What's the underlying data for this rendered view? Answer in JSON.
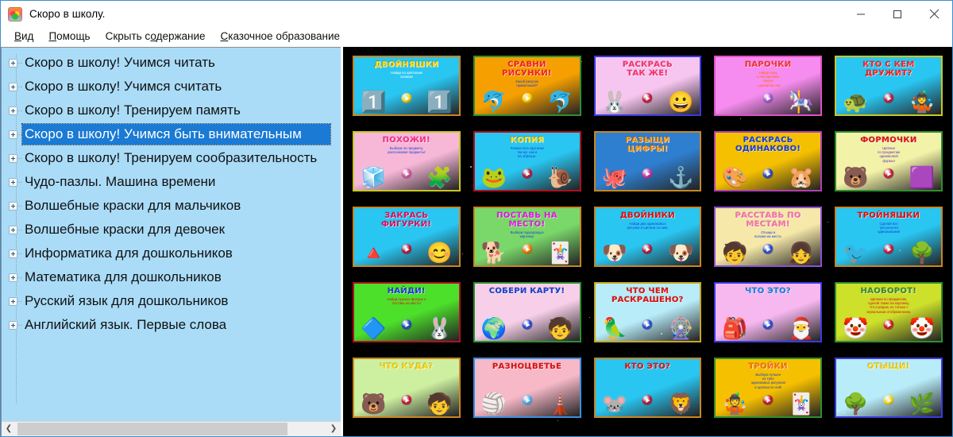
{
  "window": {
    "title": "Скоро в школу.",
    "app_icon": "school-app-icon",
    "minimize_label": "−",
    "maximize_label": "▢",
    "close_label": "✕"
  },
  "menubar": {
    "items": [
      {
        "name": "menu-view",
        "accel": "В",
        "rest": "ид"
      },
      {
        "name": "menu-help",
        "accel": "П",
        "rest": "омощь"
      },
      {
        "name": "menu-hide-contents",
        "prefix": "Скрыть с",
        "accel": "о",
        "rest": "держание"
      },
      {
        "name": "menu-fairy-education",
        "accel": "С",
        "rest": "казочное образование"
      }
    ]
  },
  "tree": {
    "items": [
      {
        "label": "Скоро в школу! Учимся читать",
        "selected": false
      },
      {
        "label": "Скоро в школу! Учимся считать",
        "selected": false
      },
      {
        "label": "Скоро в школу! Тренируем память",
        "selected": false
      },
      {
        "label": "Скоро в школу! Учимся быть внимательным",
        "selected": true
      },
      {
        "label": "Скоро в школу! Тренируем сообразительность",
        "selected": false
      },
      {
        "label": "Чудо-пазлы. Машина времени",
        "selected": false
      },
      {
        "label": "Волшебные краски для мальчиков",
        "selected": false
      },
      {
        "label": "Волшебные краски для девочек",
        "selected": false
      },
      {
        "label": "Информатика для дошкольников",
        "selected": false
      },
      {
        "label": "Математика для дошкольников",
        "selected": false
      },
      {
        "label": "Русский язык для дошкольников",
        "selected": false
      },
      {
        "label": "Английский язык. Первые слова",
        "selected": false
      }
    ],
    "hscroll": {
      "left_arrow": "❮",
      "right_arrow": "❯"
    }
  },
  "grid": {
    "thumbnails": [
      {
        "title": "ДВОЙНЯШКИ",
        "subtitle": "Найди по цветовым\nсхемам!",
        "bg": "#29c6f2",
        "border": "#c8861f",
        "title_color": "#ffd400",
        "sub_color": "#ffffff",
        "play_color": "#ffd400",
        "art_left": "1️⃣",
        "art_right": "1️⃣"
      },
      {
        "title": "СРАВНИ\nРИСУНКИ!",
        "subtitle": "Какой рисунок\nправильный?",
        "bg": "#f5a000",
        "border": "#2f8f2f",
        "title_color": "#ff2020",
        "sub_color": "#1b3fd0",
        "play_color": "#ffd400",
        "art_left": "🐬",
        "art_right": "🐬"
      },
      {
        "title": "РАСКРАСЬ\nТАК ЖЕ!",
        "subtitle": "",
        "bg": "#f7c6f0",
        "border": "#3a3ae0",
        "title_color": "#ff3070",
        "sub_color": "#1b3fd0",
        "play_color": "#c01030",
        "art_left": "🐰",
        "art_right": "😀"
      },
      {
        "title": "ПАРОЧКИ",
        "subtitle": "Найди пару\nк той картинке\nсверху\n- сделай бы им!",
        "bg": "#f78cf0",
        "border": "#e050c8",
        "title_color": "#ff3030",
        "sub_color": "#ff6a00",
        "play_color": "#9b59d0",
        "art_left": "",
        "art_right": "🎠"
      },
      {
        "title": "КТО С КЕМ\nДРУЖИТ?",
        "subtitle": "",
        "bg": "#29c6f2",
        "border": "#c8c81f",
        "title_color": "#ff2020",
        "sub_color": "#ffffff",
        "play_color": "#d01030",
        "art_left": "🐢",
        "art_right": "🤹"
      },
      {
        "title": "ПОХОЖИ!",
        "subtitle": "Выбери по предмету,\nраспознавая предметы!",
        "bg": "#f7b8d8",
        "border": "#c8c81f",
        "title_color": "#ff3090",
        "sub_color": "#1b3fd0",
        "play_color": "#d050a0",
        "art_left": "🧊",
        "art_right": "🧩"
      },
      {
        "title": "КОПИЯ",
        "subtitle": "Разместите картинки\nтак же, как и\nна образце.",
        "bg": "#29c6f2",
        "border": "#b01020",
        "title_color": "#ffd400",
        "sub_color": "#1b3fd0",
        "play_color": "#c01030",
        "art_left": "🐸",
        "art_right": "🐌"
      },
      {
        "title": "РАЗЫЩИ\nЦИФРЫ!",
        "subtitle": "",
        "bg": "#2f7fd0",
        "border": "#c8861f",
        "title_color": "#ff9000",
        "sub_color": "#ffffff",
        "play_color": "#e030a0",
        "art_left": "🐙",
        "art_right": "⚓"
      },
      {
        "title": "РАСКРАСЬ\nОДИНАКОВО!",
        "subtitle": "",
        "bg": "#f5c000",
        "border": "#b040b0",
        "title_color": "#1b3fd0",
        "sub_color": "#1b3fd0",
        "play_color": "#2040d0",
        "art_left": "🎨",
        "art_right": "🐹"
      },
      {
        "title": "ФОРМОЧКИ",
        "subtitle": "Щёлкни\nпо предметам\nодинаковой\nформы!",
        "bg": "#f2f2a8",
        "border": "#2f8f2f",
        "title_color": "#e01010",
        "sub_color": "#7030c0",
        "play_color": "#c01030",
        "art_left": "🐻",
        "art_right": "🟪"
      },
      {
        "title": "ЗАКРАСЬ\nФИГУРКИ!",
        "subtitle": "",
        "bg": "#29c6f2",
        "border": "#c8861f",
        "title_color": "#e01060",
        "sub_color": "#ffffff",
        "play_color": "#c01030",
        "art_left": "🔺",
        "art_right": "😊"
      },
      {
        "title": "ПОСТАВЬ НА\nМЕСТО!",
        "subtitle": "Выбери подходящую\nкартинку.",
        "bg": "#7ad86a",
        "border": "#c8861f",
        "title_color": "#e020e0",
        "sub_color": "#1b3fd0",
        "play_color": "#ff7000",
        "art_left": "🐕",
        "art_right": "🃏"
      },
      {
        "title": "ДВОЙНИКИ",
        "subtitle": "Найди два одинаковых\nрисунка и щёлкни по ним.",
        "bg": "#29c6f2",
        "border": "#c8861f",
        "title_color": "#e01010",
        "sub_color": "#1b3fd0",
        "play_color": "#c01030",
        "art_left": "🐶",
        "art_right": "🐶"
      },
      {
        "title": "РАССТАВЬ ПО\nМЕСТАМ!",
        "subtitle": "Отыщи и\nположи на место.",
        "bg": "#f5e8a8",
        "border": "#9050d0",
        "title_color": "#ff70b0",
        "sub_color": "#1b3fd0",
        "play_color": "#2040d0",
        "art_left": "🧒",
        "art_right": "👧"
      },
      {
        "title": "ТРОЙНЯШКИ",
        "subtitle": "Сделай все\nтри рисунка\nодинаковыми!",
        "bg": "#29c6f2",
        "border": "#c8861f",
        "title_color": "#e01010",
        "sub_color": "#1b3fd0",
        "play_color": "#d01030",
        "art_left": "🐦",
        "art_right": "🌳"
      },
      {
        "title": "НАЙДИ!",
        "subtitle": "Найди нужные фигуры и\nпоставь на место!",
        "bg": "#4ce02a",
        "border": "#b01020",
        "title_color": "#1b3fd0",
        "sub_color": "#e01010",
        "play_color": "#2040d0",
        "art_left": "🔷",
        "art_right": "🐰"
      },
      {
        "title": "СОБЕРИ КАРТУ!",
        "subtitle": "",
        "bg": "#f7cfe8",
        "border": "#2f8f2f",
        "title_color": "#1b3fd0",
        "sub_color": "#1b3fd0",
        "play_color": "#2040d0",
        "art_left": "🌍",
        "art_right": "🧒"
      },
      {
        "title": "ЧТО ЧЕМ\nРАСКРАШЕНО?",
        "subtitle": "",
        "bg": "#b8ecf8",
        "border": "#c8a81f",
        "title_color": "#e01010",
        "sub_color": "#1b3fd0",
        "play_color": "#2040d0",
        "art_left": "🦜",
        "art_right": "🎡"
      },
      {
        "title": "ЧТО ЭТО?",
        "subtitle": "",
        "bg": "#f7b8f0",
        "border": "#3a3ae0",
        "title_color": "#1b80e0",
        "sub_color": "#1b3fd0",
        "play_color": "#2040d0",
        "art_left": "🎒",
        "art_right": "🎅"
      },
      {
        "title": "НАОБОРОТ!",
        "subtitle": "Щёлкни по предметам,\nсделай также на картинку,\nчто и рядом, но только с\nзеркальным отображением.",
        "bg": "#cde02a",
        "border": "#2f8f2f",
        "title_color": "#3a8f20",
        "sub_color": "#e01010",
        "play_color": "#d01030",
        "art_left": "🤡",
        "art_right": "🤡"
      },
      {
        "title": "ЧТО КУДА?",
        "subtitle": "",
        "bg": "#cdf0a0",
        "border": "#c8861f",
        "title_color": "#ffd400",
        "sub_color": "#1b3fd0",
        "play_color": "#c01030",
        "art_left": "🐻",
        "art_right": "🧒"
      },
      {
        "title": "РАЗНОЦВЕТЬЕ",
        "subtitle": "",
        "bg": "#f7b8c8",
        "border": "#3a8fe0",
        "title_color": "#e01010",
        "sub_color": "#1b3fd0",
        "play_color": "#40b0f0",
        "art_left": "🏐",
        "art_right": "🗼"
      },
      {
        "title": "КТО ЭТО?",
        "subtitle": "",
        "bg": "#29c6f2",
        "border": "#c8861f",
        "title_color": "#e01010",
        "sub_color": "#1b3fd0",
        "play_color": "#c01030",
        "art_left": "🐭",
        "art_right": "🦁"
      },
      {
        "title": "ТРОЙКИ",
        "subtitle": "Выбери лучшее\nиз трёх\nодинаковых рисунков\nи щёлкни по ней!",
        "bg": "#f5c000",
        "border": "#2f8f2f",
        "title_color": "#ff7000",
        "sub_color": "#1b3fd0",
        "play_color": "#c01030",
        "art_left": "🤹",
        "art_right": "🃏"
      },
      {
        "title": "ОТЫЩИ!",
        "subtitle": "",
        "bg": "#b8ecf8",
        "border": "#3a3ae0",
        "title_color": "#ffd400",
        "sub_color": "#1b3fd0",
        "play_color": "#ffd400",
        "art_left": "🌳",
        "art_right": "🌿"
      }
    ]
  }
}
